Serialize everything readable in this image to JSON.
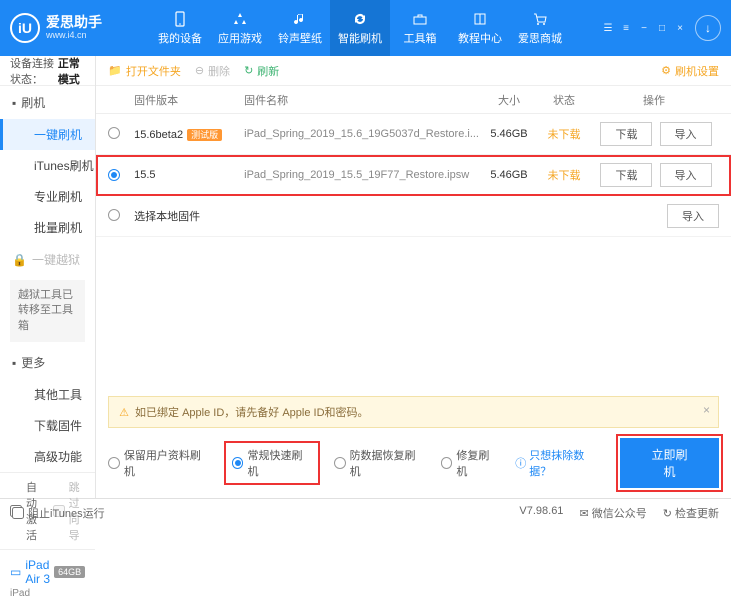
{
  "brand": {
    "name": "爱思助手",
    "url": "www.i4.cn",
    "logo_letter": "iU"
  },
  "nav": {
    "items": [
      {
        "label": "我的设备"
      },
      {
        "label": "应用游戏"
      },
      {
        "label": "铃声壁纸"
      },
      {
        "label": "智能刷机"
      },
      {
        "label": "工具箱"
      },
      {
        "label": "教程中心"
      },
      {
        "label": "爱思商城"
      }
    ],
    "active_index": 3
  },
  "sidebar": {
    "conn_label": "设备连接状态：",
    "conn_value": "正常模式",
    "groups": [
      {
        "title": "刷机",
        "items": [
          "一键刷机",
          "iTunes刷机",
          "专业刷机",
          "批量刷机"
        ],
        "active_index": 0
      },
      {
        "title": "一键越狱",
        "note": "越狱工具已转移至工具箱"
      },
      {
        "title": "更多",
        "items": [
          "其他工具",
          "下载固件",
          "高级功能"
        ]
      }
    ],
    "checks": {
      "auto_activate": "自动激活",
      "skip_guide": "跳过向导"
    },
    "device": {
      "name": "iPad Air 3",
      "storage": "64GB",
      "sub": "iPad"
    }
  },
  "toolbar": {
    "open_folder": "打开文件夹",
    "delete": "删除",
    "refresh": "刷新",
    "settings": "刷机设置"
  },
  "table": {
    "headers": {
      "version": "固件版本",
      "name": "固件名称",
      "size": "大小",
      "status": "状态",
      "ops": "操作"
    },
    "rows": [
      {
        "selected": false,
        "version": "15.6beta2",
        "beta_tag": "测试版",
        "name": "iPad_Spring_2019_15.6_19G5037d_Restore.i...",
        "size": "5.46GB",
        "status": "未下载",
        "btn1": "下载",
        "btn2": "导入"
      },
      {
        "selected": true,
        "version": "15.5",
        "beta_tag": "",
        "name": "iPad_Spring_2019_15.5_19F77_Restore.ipsw",
        "size": "5.46GB",
        "status": "未下载",
        "btn1": "下载",
        "btn2": "导入"
      }
    ],
    "local_row": {
      "label": "选择本地固件",
      "btn": "导入"
    }
  },
  "warning": "如已绑定 Apple ID，请先备好 Apple ID和密码。",
  "modes": {
    "opts": [
      "保留用户资料刷机",
      "常规快速刷机",
      "防数据恢复刷机",
      "修复刷机"
    ],
    "selected_index": 1,
    "only_erase": "只想抹除数据？",
    "flash_btn": "立即刷机"
  },
  "footer": {
    "block_itunes": "阻止iTunes运行",
    "version": "V7.98.61",
    "wechat": "微信公众号",
    "check_update": "检查更新"
  }
}
